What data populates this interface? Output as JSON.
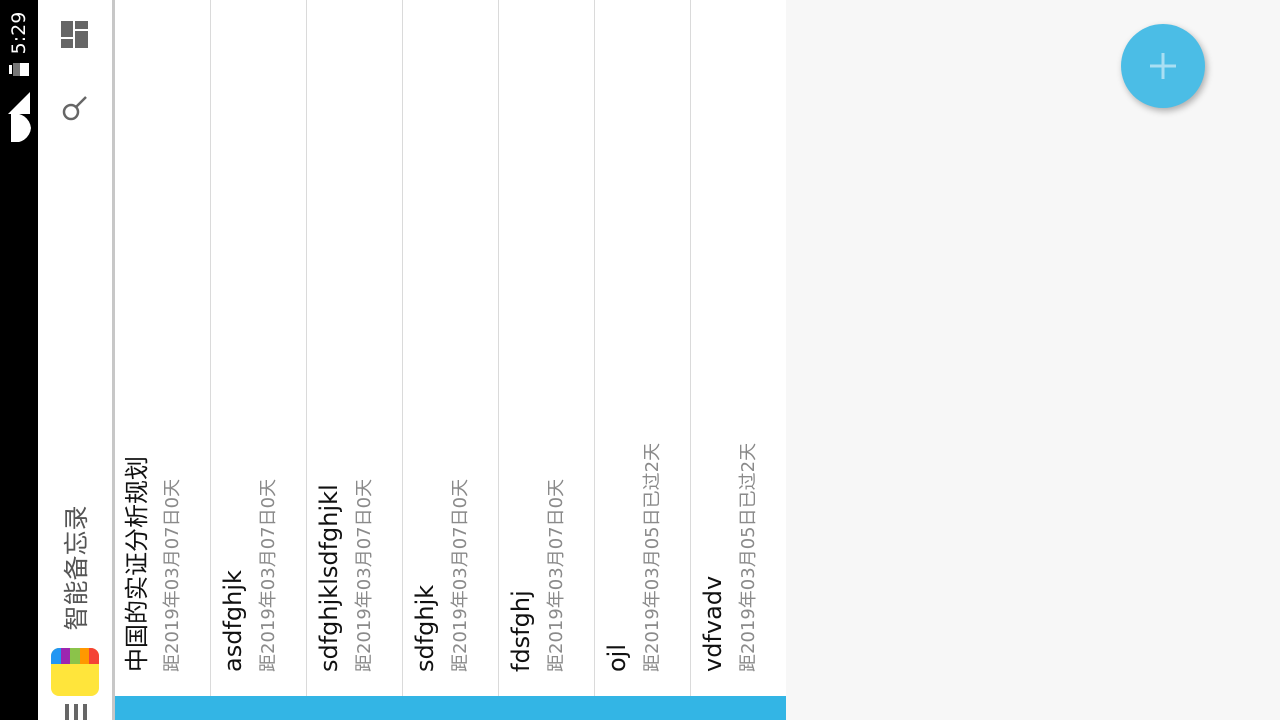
{
  "status_bar": {
    "time": "5:29",
    "icons": [
      "battery-icon",
      "signal-icon",
      "wifi-icon"
    ]
  },
  "toolbar": {
    "app_title": "智能备忘录",
    "icons": [
      "grid-icon",
      "search-icon",
      "app-logo",
      "menu-icon"
    ]
  },
  "memos": [
    {
      "title": "中国的实证分析规划",
      "subtitle": "距2019年03月07日0天"
    },
    {
      "title": "asdfghjk",
      "subtitle": "距2019年03月07日0天"
    },
    {
      "title": "sdfghjklsdfghjkl",
      "subtitle": "距2019年03月07日0天"
    },
    {
      "title": "sdfghjk",
      "subtitle": "距2019年03月07日0天"
    },
    {
      "title": "fdsfghj",
      "subtitle": "距2019年03月07日0天"
    },
    {
      "title": "ojl",
      "subtitle": "距2019年03月05日已过2天"
    },
    {
      "title": "vdfvadv",
      "subtitle": "距2019年03月05日已过2天"
    }
  ],
  "fab": {
    "icon": "plus-icon"
  },
  "colors": {
    "accent": "#33b5e5",
    "fab": "#4bbde6",
    "status_bar": "#000000"
  }
}
